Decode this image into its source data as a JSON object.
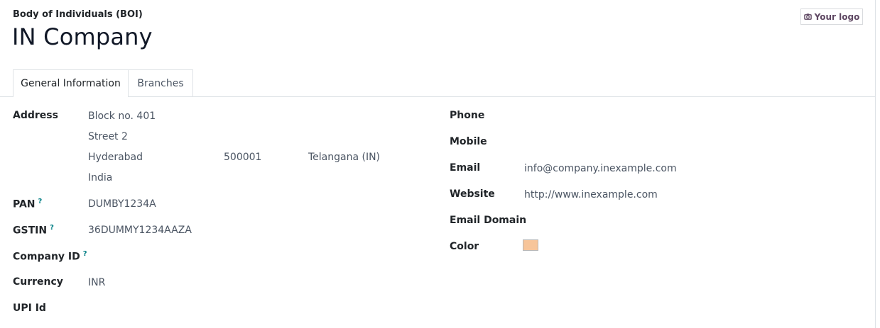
{
  "header": {
    "type_label": "Body of Individuals (BOI)",
    "company_name": "IN Company",
    "logo_button": "Your logo",
    "logo_icon": "camera-icon"
  },
  "tabs": [
    {
      "label": "General Information",
      "active": true
    },
    {
      "label": "Branches",
      "active": false
    }
  ],
  "left_fields": {
    "address_label": "Address",
    "address": {
      "street": "Block no. 401",
      "street2": "Street 2",
      "city": "Hyderabad",
      "zip": "500001",
      "state": "Telangana (IN)",
      "country": "India"
    },
    "pan_label": "PAN",
    "pan_help": "?",
    "pan_value": "DUMBY1234A",
    "gstin_label": "GSTIN",
    "gstin_help": "?",
    "gstin_value": "36DUMMY1234AAZA",
    "company_id_label": "Company ID",
    "company_id_help": "?",
    "company_id_value": "",
    "currency_label": "Currency",
    "currency_value": "INR",
    "upi_label": "UPI Id",
    "upi_value": ""
  },
  "right_fields": {
    "phone_label": "Phone",
    "phone_value": "",
    "mobile_label": "Mobile",
    "mobile_value": "",
    "email_label": "Email",
    "email_value": "info@company.inexample.com",
    "website_label": "Website",
    "website_value": "http://www.inexample.com",
    "email_domain_label": "Email Domain",
    "email_domain_value": "",
    "color_label": "Color",
    "color_value": "#f7c59a"
  }
}
